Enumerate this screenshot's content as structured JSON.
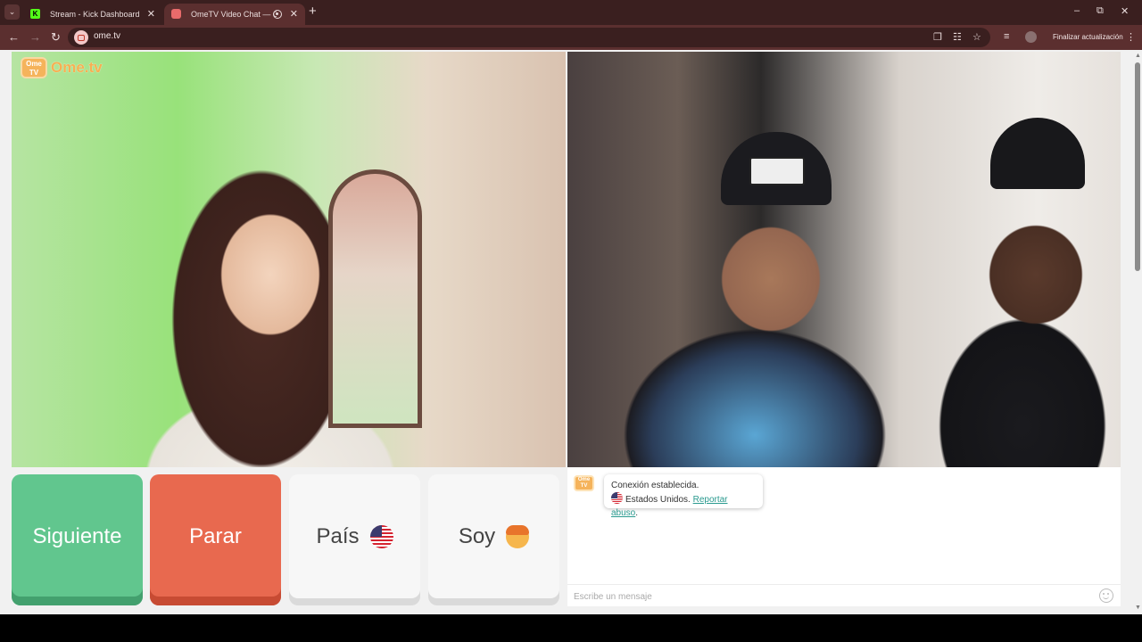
{
  "browser": {
    "tabs": [
      {
        "title": "Stream - Kick Dashboard",
        "favicon": "kick-icon"
      },
      {
        "title": "OmeTV Video Chat — Omegle",
        "favicon": "ometv-icon",
        "active": true,
        "recording": true
      }
    ],
    "url": "ome.tv",
    "update_label": "Finalizar actualización"
  },
  "page": {
    "logo_text": "Ome.tv",
    "logo_badge": "Ome TV",
    "buttons": {
      "next": "Siguiente",
      "stop": "Parar",
      "country": "País",
      "soy": "Soy"
    },
    "chat": {
      "badge": "Ome TV",
      "connected": "Conexión establecida.",
      "country": "Estados Unidos.",
      "report_link": "Reportar abuso",
      "report_suffix": ".",
      "input_placeholder": "Escribe un mensaje"
    }
  },
  "colors": {
    "chrome_dark": "#3a1f1f",
    "chrome_toolbar": "#5b2f2f",
    "next_green": "#61c68e",
    "stop_red": "#e8694f",
    "logo_orange": "#f6b052",
    "link_teal": "#2a9a8f"
  }
}
